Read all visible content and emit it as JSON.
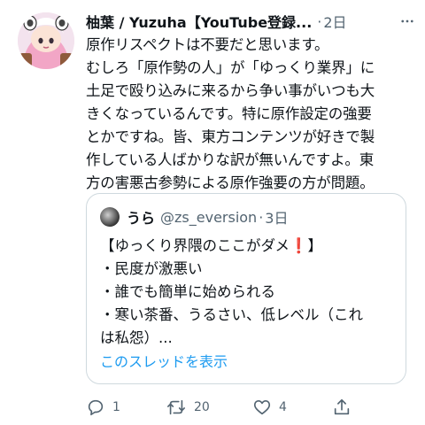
{
  "tweet": {
    "author_name": "柚葉 / Yuzuha【YouTube登録...",
    "separator": "·",
    "time": "2日",
    "lines": [
      "原作リスペクトは不要だと思います。",
      "むしろ「原作勢の人」が「ゆっくり業界」に",
      "土足で殴り込みに来るから争い事がいつも大",
      "きくなっているんです。特に原作設定の強要",
      "とかですね。皆、東方コンテンツが好きで製",
      "作している人ばかりな訳が無いんですよ。東",
      "方の害悪古参勢による原作強要の方が問題。"
    ]
  },
  "quote": {
    "name": "うら",
    "handle": "@zs_eversion",
    "separator": "·",
    "time": "3日",
    "lines": [
      "【ゆっくり界隈のここがダメ❗】",
      "・民度が激悪い",
      "・誰でも簡単に始められる",
      "・寒い茶番、うるさい、低レベル（これ",
      "は私怨）..."
    ],
    "show_thread": "このスレッドを表示"
  },
  "actions": {
    "reply_count": "1",
    "retweet_count": "20",
    "like_count": "4",
    "share_label": ""
  },
  "colors": {
    "text": "#0f1419",
    "secondary": "#536471",
    "link": "#1d9bf0",
    "border": "#cfd9de",
    "exclamation": "#e0245e"
  },
  "icons": [
    "avatar-icon",
    "more-icon",
    "reply-icon",
    "retweet-icon",
    "like-icon",
    "share-icon"
  ]
}
